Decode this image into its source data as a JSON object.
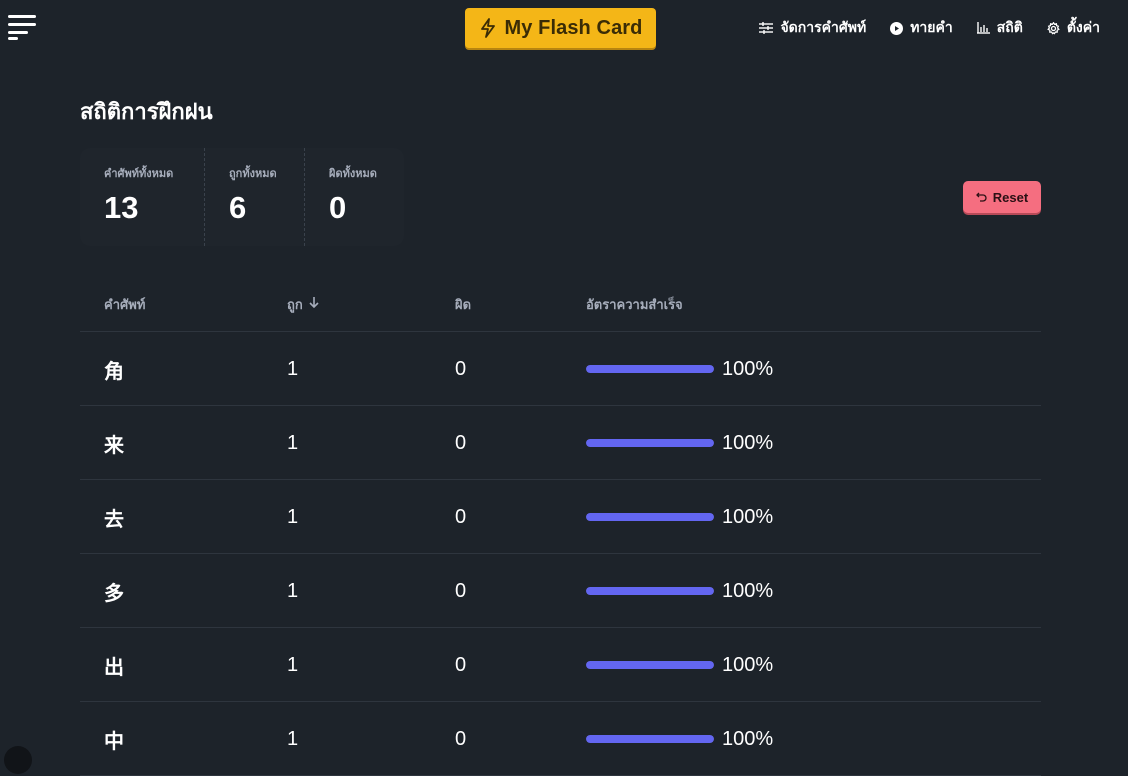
{
  "header": {
    "brand_label": "My Flash Card",
    "brand_color": "#f4b617",
    "brand_icon": "lightning-icon",
    "nav": [
      {
        "label": "จัดการคำศัพท์",
        "icon": "sliders-icon"
      },
      {
        "label": "ทายคำ",
        "icon": "play-circle-icon"
      },
      {
        "label": "สถิติ",
        "icon": "bar-chart-icon"
      },
      {
        "label": "ตั้งค่า",
        "icon": "gear-icon"
      }
    ]
  },
  "page": {
    "title": "สถิติการฝึกฝน"
  },
  "stats": [
    {
      "title": "คำศัพท์ทั้งหมด",
      "value": "13"
    },
    {
      "title": "ถูกทั้งหมด",
      "value": "6"
    },
    {
      "title": "ผิดทั้งหมด",
      "value": "0"
    }
  ],
  "reset": {
    "label": "Reset",
    "icon": "undo-icon",
    "color": "#f56e80"
  },
  "table": {
    "headers": {
      "word": "คำศัพท์",
      "correct": "ถูก",
      "wrong": "ผิด",
      "rate": "อัตราความสำเร็จ"
    },
    "sort_icon": "arrow-down-icon",
    "bar_color": "#6366f1",
    "rows": [
      {
        "word": "角",
        "correct": "1",
        "wrong": "0",
        "rate": 1.0,
        "rate_label": "100%"
      },
      {
        "word": "来",
        "correct": "1",
        "wrong": "0",
        "rate": 1.0,
        "rate_label": "100%"
      },
      {
        "word": "去",
        "correct": "1",
        "wrong": "0",
        "rate": 1.0,
        "rate_label": "100%"
      },
      {
        "word": "多",
        "correct": "1",
        "wrong": "0",
        "rate": 1.0,
        "rate_label": "100%"
      },
      {
        "word": "出",
        "correct": "1",
        "wrong": "0",
        "rate": 1.0,
        "rate_label": "100%"
      },
      {
        "word": "中",
        "correct": "1",
        "wrong": "0",
        "rate": 1.0,
        "rate_label": "100%"
      }
    ]
  }
}
